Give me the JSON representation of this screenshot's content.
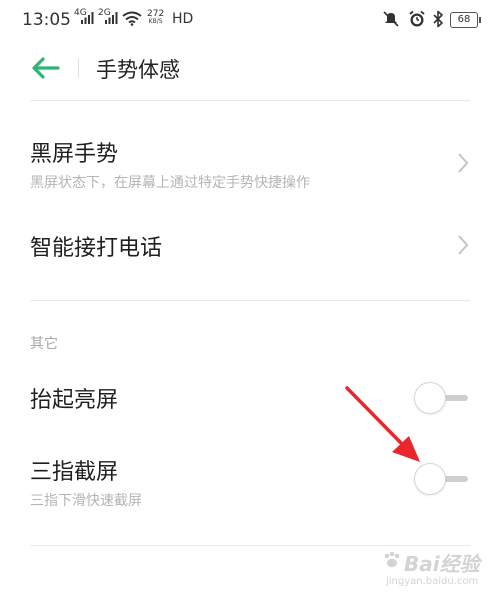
{
  "status_bar": {
    "time": "13:05",
    "net1": "4G",
    "net2": "2G",
    "speed_value": "272",
    "speed_unit": "KB/S",
    "hd": "HD",
    "battery": "68",
    "icons": [
      "signal-icon",
      "wifi-icon",
      "mute-icon",
      "alarm-icon",
      "bluetooth-icon",
      "battery-icon"
    ]
  },
  "header": {
    "title": "手势体感",
    "back_icon": "back-arrow-icon",
    "accent_color": "#2bb673"
  },
  "items": [
    {
      "title": "黑屏手势",
      "subtitle": "黑屏状态下，在屏幕上通过特定手势快捷操作",
      "control": "chevron"
    },
    {
      "title": "智能接打电话",
      "control": "chevron"
    }
  ],
  "other_section": {
    "label": "其它",
    "items": [
      {
        "title": "抬起亮屏",
        "toggle_on": false
      },
      {
        "title": "三指截屏",
        "subtitle": "三指下滑快速截屏",
        "toggle_on": false
      }
    ]
  },
  "annotation": {
    "color": "#e8262b",
    "target": "three-finger-screenshot-toggle"
  },
  "watermark": {
    "text": "Bai经验",
    "url": "jingyan.baidu.com"
  }
}
